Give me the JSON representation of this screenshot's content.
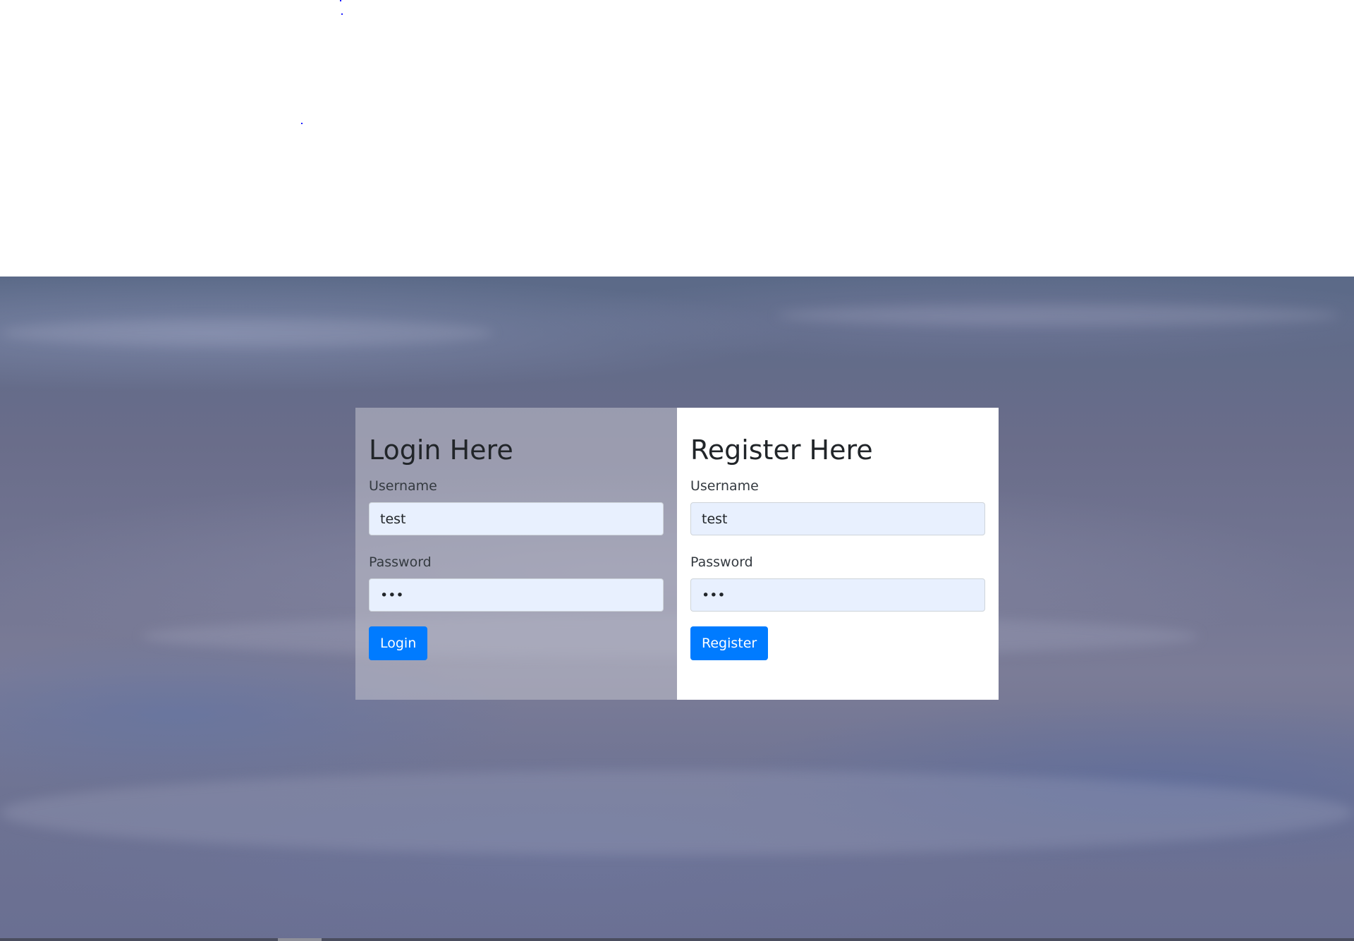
{
  "login": {
    "title": "Login Here",
    "username_label": "Username",
    "username_value": "test",
    "password_label": "Password",
    "password_value": "abc",
    "button_label": "Login"
  },
  "register": {
    "title": "Register Here",
    "username_label": "Username",
    "username_value": "test",
    "password_label": "Password",
    "password_value": "abc",
    "button_label": "Register"
  },
  "colors": {
    "button": "#007bff",
    "input_autofill_bg": "#e8f0fe",
    "heading_text": "#212529"
  }
}
